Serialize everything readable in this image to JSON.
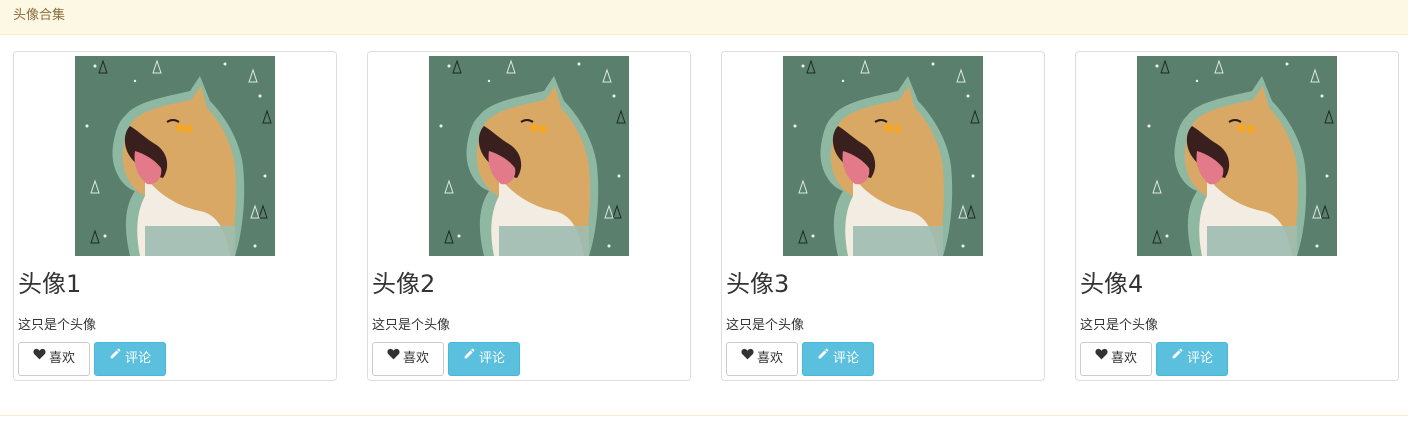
{
  "panel": {
    "heading": "头像合集"
  },
  "cards": [
    {
      "title": "头像1",
      "description": "这只是个头像",
      "like_label": "喜欢",
      "comment_label": "评论"
    },
    {
      "title": "头像2",
      "description": "这只是个头像",
      "like_label": "喜欢",
      "comment_label": "评论"
    },
    {
      "title": "头像3",
      "description": "这只是个头像",
      "like_label": "喜欢",
      "comment_label": "评论"
    },
    {
      "title": "头像4",
      "description": "这只是个头像",
      "like_label": "喜欢",
      "comment_label": "评论"
    }
  ],
  "icons": {
    "like": "heart-icon",
    "comment": "pencil-icon"
  },
  "colors": {
    "heading_bg": "#fcf8e3",
    "heading_text": "#8a6d3b",
    "info_button": "#5bc0de",
    "image_bg": "#5a7f6c"
  }
}
